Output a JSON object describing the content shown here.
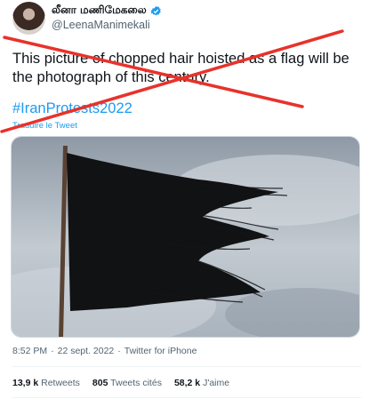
{
  "author": {
    "display_name": "லீனா மணிமேகலை",
    "handle": "@LeenaManimekali"
  },
  "tweet": {
    "text": "This picture of chopped hair hoisted as a flag will be the photograph of this century.",
    "hashtag": "#IranProtests2022",
    "translate_label": "Traduire le Tweet"
  },
  "meta": {
    "time": "8:52 PM",
    "separator": "·",
    "date": "22 sept. 2022",
    "source": "Twitter for iPhone"
  },
  "stats": {
    "retweets_count": "13,9 k",
    "retweets_label": "Retweets",
    "quotes_count": "805",
    "quotes_label": "Tweets cités",
    "likes_count": "58,2 k",
    "likes_label": "J'aime"
  },
  "colors": {
    "link": "#1d9bf0",
    "cross": "#e8322a",
    "verified": "#1d9bf0"
  },
  "icons": [
    "avatar",
    "verified-badge-icon"
  ]
}
